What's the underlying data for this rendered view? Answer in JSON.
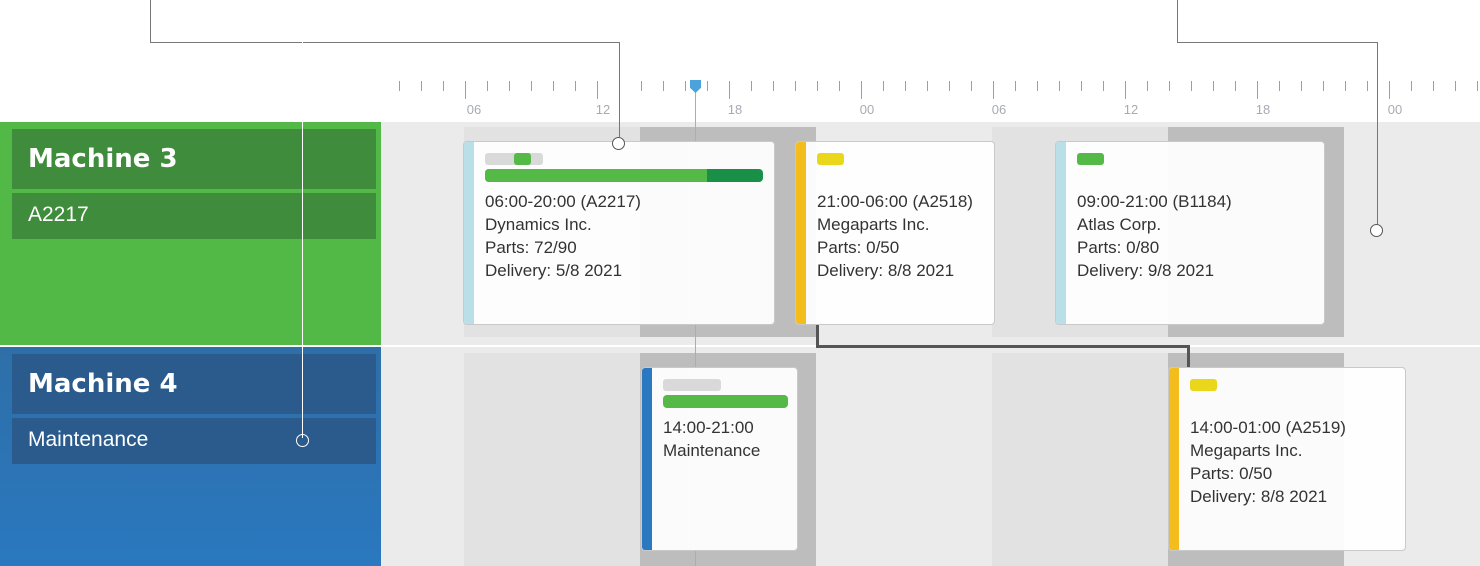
{
  "timeline": {
    "hour_labels": [
      "06",
      "12",
      "18",
      "00",
      "06",
      "12",
      "18",
      "00"
    ]
  },
  "resources": [
    {
      "name": "Machine 3",
      "status": "A2217",
      "color": "#52b947"
    },
    {
      "name": "Machine 4",
      "status": "Maintenance",
      "color": "#2a78bf"
    }
  ],
  "tasks": [
    {
      "time": "06:00-20:00 (A2217)",
      "customer": "Dynamics Inc.",
      "parts": "Parts: 72/90",
      "delivery": "Delivery: 5/8 2021",
      "stripe_color": "#b9dfe8",
      "progress": 0.8
    },
    {
      "time": "21:00-06:00 (A2518)",
      "customer": "Megaparts Inc.",
      "parts": "Parts: 0/50",
      "delivery": "Delivery: 8/8 2021",
      "stripe_color": "#f2bd1d",
      "chip_color": "#ead61b"
    },
    {
      "time": "09:00-21:00 (B1184)",
      "customer": "Atlas Corp.",
      "parts": "Parts: 0/80",
      "delivery": "Delivery: 9/8 2021",
      "stripe_color": "#b9dfe8",
      "chip_color": "#55b947"
    },
    {
      "time": "14:00-21:00",
      "customer": "Maintenance",
      "stripe_color": "#2a78bf",
      "progress": 1.0
    },
    {
      "time": "14:00-01:00 (A2519)",
      "customer": "Megaparts Inc.",
      "parts": "Parts: 0/50",
      "delivery": "Delivery: 8/8 2021",
      "stripe_color": "#f2bd1d",
      "chip_color": "#ead61b"
    }
  ],
  "colors": {
    "lane_bg": "#ebebeb",
    "now_line": "#79bde6",
    "dependency": "#555555"
  }
}
